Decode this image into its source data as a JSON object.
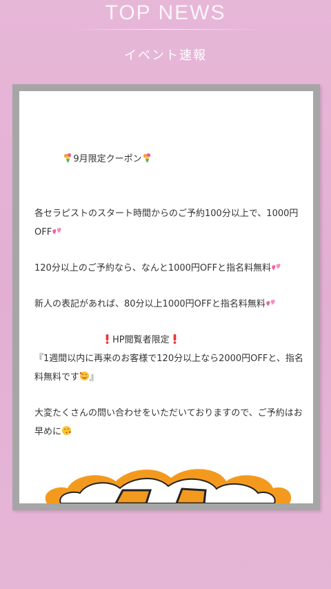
{
  "header": {
    "title": "TOP NEWS",
    "subtitle": "イベント速報"
  },
  "article": {
    "heading": "9月限定クーポン",
    "para1": "各セラピストのスタート時間からのご予約100分以上で、1000円OFF",
    "para2": "120分以上のご予約なら、なんと1000円OFFと指名料無料",
    "para3": "新人の表記があれば、80分以上1000円OFFと指名料無料",
    "hp_heading": "HP閲覧者限定",
    "quote": "『1週間以内に再来のお客様で120分以上なら2000円OFFと、指名料無料です",
    "quote_close": "』",
    "closing": "大変たくさんの問い合わせをいただいておりますので、ご予約はお早めに"
  },
  "icons": {
    "flower": "bouquet-icon",
    "hearts": "two-hearts-icon",
    "exclaim": "red-exclamation-icon",
    "smiling_hearts": "smiling-face-with-hearts-icon",
    "kiss": "face-blowing-kiss-icon"
  },
  "colors": {
    "background": "#e6b4d6",
    "frame": "#a6a6a6",
    "card": "#ffffff",
    "text": "#333333",
    "heart": "#f25fa3",
    "banner_orange": "#f39a1e"
  }
}
